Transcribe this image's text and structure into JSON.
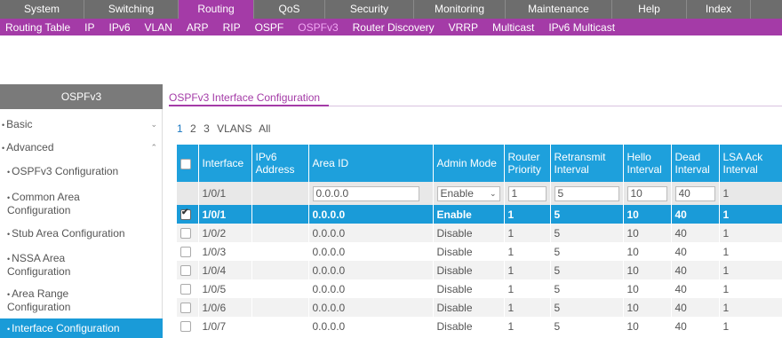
{
  "topnav": {
    "tabs": [
      {
        "label": "System",
        "active": false
      },
      {
        "label": "Switching",
        "active": false
      },
      {
        "label": "Routing",
        "active": true
      },
      {
        "label": "QoS",
        "active": false
      },
      {
        "label": "Security",
        "active": false
      },
      {
        "label": "Monitoring",
        "active": false
      },
      {
        "label": "Maintenance",
        "active": false
      },
      {
        "label": "Help",
        "active": false
      },
      {
        "label": "Index",
        "active": false
      }
    ]
  },
  "subnav": {
    "items": [
      {
        "label": "Routing Table",
        "active": false
      },
      {
        "label": "IP",
        "active": false
      },
      {
        "label": "IPv6",
        "active": false
      },
      {
        "label": "VLAN",
        "active": false
      },
      {
        "label": "ARP",
        "active": false
      },
      {
        "label": "RIP",
        "active": false
      },
      {
        "label": "OSPF",
        "active": false
      },
      {
        "label": "OSPFv3",
        "active": true
      },
      {
        "label": "Router Discovery",
        "active": false
      },
      {
        "label": "VRRP",
        "active": false
      },
      {
        "label": "Multicast",
        "active": false
      },
      {
        "label": "IPv6 Multicast",
        "active": false
      }
    ]
  },
  "sidebar": {
    "title": "OSPFv3",
    "basic": "Basic",
    "advanced": "Advanced",
    "items": [
      {
        "label": "OSPFv3 Configuration",
        "active": false
      },
      {
        "label": "Common Area Configuration",
        "active": false
      },
      {
        "label": "Stub Area Configuration",
        "active": false
      },
      {
        "label": "NSSA Area Configuration",
        "active": false
      },
      {
        "label": "Area Range Configuration",
        "active": false
      },
      {
        "label": "Interface Configuration",
        "active": true
      }
    ]
  },
  "content": {
    "title": "OSPFv3 Interface Configuration",
    "pager": [
      "1",
      "2",
      "3",
      "VLANS",
      "All"
    ]
  },
  "table": {
    "headers": [
      "Interface",
      "IPv6 Address",
      "Area ID",
      "Admin Mode",
      "Router Priority",
      "Retransmit Interval",
      "Hello Interval",
      "Dead Interval",
      "LSA Ack Interval"
    ],
    "edit_row": {
      "interface": "1/0/1",
      "area": "0.0.0.0",
      "mode": "Enable",
      "priority": "1",
      "retransmit": "5",
      "hello": "10",
      "dead": "40",
      "lsa": "1"
    },
    "rows": [
      {
        "checked": true,
        "interface": "1/0/1",
        "ipv6": "",
        "area": "0.0.0.0",
        "mode": "Enable",
        "priority": "1",
        "retransmit": "5",
        "hello": "10",
        "dead": "40",
        "lsa": "1"
      },
      {
        "checked": false,
        "interface": "1/0/2",
        "ipv6": "",
        "area": "0.0.0.0",
        "mode": "Disable",
        "priority": "1",
        "retransmit": "5",
        "hello": "10",
        "dead": "40",
        "lsa": "1"
      },
      {
        "checked": false,
        "interface": "1/0/3",
        "ipv6": "",
        "area": "0.0.0.0",
        "mode": "Disable",
        "priority": "1",
        "retransmit": "5",
        "hello": "10",
        "dead": "40",
        "lsa": "1"
      },
      {
        "checked": false,
        "interface": "1/0/4",
        "ipv6": "",
        "area": "0.0.0.0",
        "mode": "Disable",
        "priority": "1",
        "retransmit": "5",
        "hello": "10",
        "dead": "40",
        "lsa": "1"
      },
      {
        "checked": false,
        "interface": "1/0/5",
        "ipv6": "",
        "area": "0.0.0.0",
        "mode": "Disable",
        "priority": "1",
        "retransmit": "5",
        "hello": "10",
        "dead": "40",
        "lsa": "1"
      },
      {
        "checked": false,
        "interface": "1/0/6",
        "ipv6": "",
        "area": "0.0.0.0",
        "mode": "Disable",
        "priority": "1",
        "retransmit": "5",
        "hello": "10",
        "dead": "40",
        "lsa": "1"
      },
      {
        "checked": false,
        "interface": "1/0/7",
        "ipv6": "",
        "area": "0.0.0.0",
        "mode": "Disable",
        "priority": "1",
        "retransmit": "5",
        "hello": "10",
        "dead": "40",
        "lsa": "1"
      }
    ]
  },
  "colors": {
    "accent": "#a43ba7",
    "blue": "#1a9bd8",
    "nav": "#6d6d6d"
  }
}
